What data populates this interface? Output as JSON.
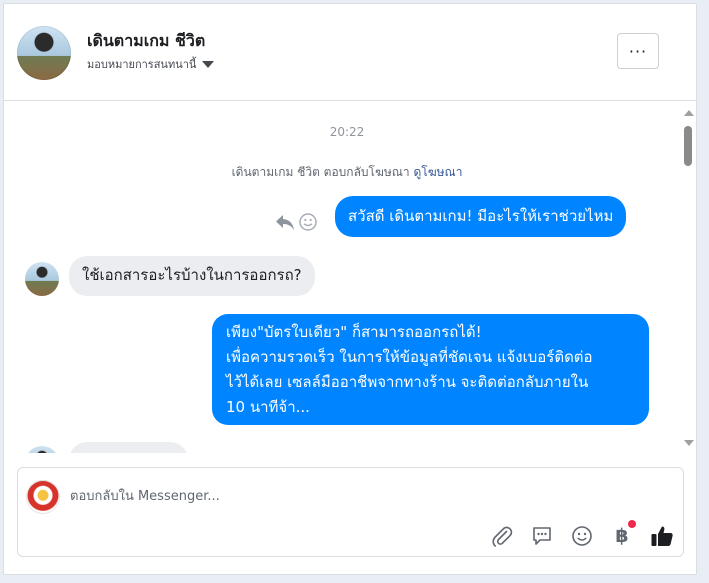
{
  "header": {
    "contact_name": "เดินตามเกม ชีวิต",
    "assign_label": "มอบหมายการสนทนานี้",
    "more_label": "···"
  },
  "conversation": {
    "timestamp": "20:22",
    "notice_prefix": "เดินตามเกม ชีวิต ตอบกลับโฆษณา",
    "notice_link": "ดูโฆษณา",
    "messages": [
      {
        "direction": "outgoing",
        "lines": [
          "สวัสดี เดินตามเกม! มีอะไรให้เราช่วยไหม"
        ]
      },
      {
        "direction": "incoming",
        "lines": [
          "ใช้เอกสารอะไรบ้างในการออกรถ?"
        ]
      },
      {
        "direction": "outgoing",
        "lines": [
          "เพียง\"บัตรใบเดียว\" ก็สามารถออกรถได้!",
          "เพื่อความรวดเร็ว ในการให้ข้อมูลที่ชัดเจน แจ้งเบอร์ติดต่อ",
          "ไว้ได้เลย เซลล์มืออาชีพจากทางร้าน จะติดต่อกลับภายใน",
          "10 นาทีจ้า..."
        ]
      }
    ]
  },
  "composer": {
    "placeholder": "ตอบกลับใน Messenger...",
    "value": "",
    "baht_symbol": "฿"
  },
  "colors": {
    "accent": "#0084ff",
    "incoming_bubble": "#ebedf0",
    "notification_dot": "#f02849",
    "link": "#385898"
  }
}
